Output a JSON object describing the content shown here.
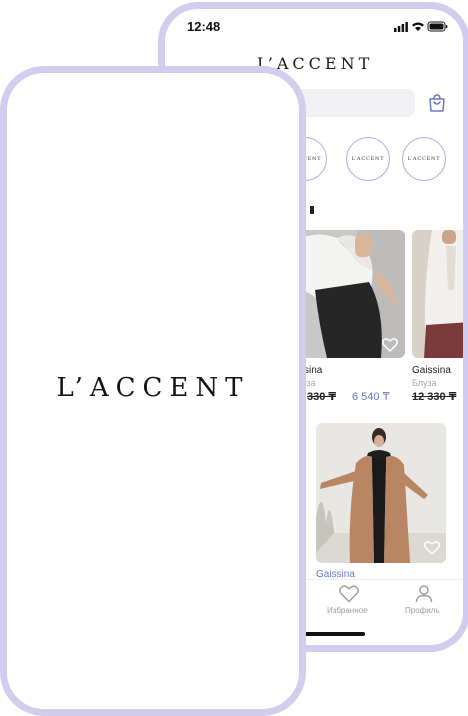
{
  "status": {
    "time": "12:48"
  },
  "brand": {
    "logo": "L’ACCENT"
  },
  "stories": [
    {
      "label": "L’ACCENT"
    },
    {
      "label": "L’ACCENT"
    },
    {
      "label": "L’ACCENT"
    }
  ],
  "products": [
    {
      "brand": "ssina",
      "category": "уза",
      "old_price": "330 ₸",
      "new_price": "6 540 ₸"
    },
    {
      "brand": "Gaissina",
      "category": "Блуза",
      "old_price": "12 330 ₸"
    },
    {
      "brand": "Gaissina"
    }
  ],
  "tabs": [
    {
      "label": "Избранное",
      "icon": "heart-icon"
    },
    {
      "label": "Профиль",
      "icon": "profile-icon"
    }
  ],
  "splash": {
    "logo": "L’ACCENT"
  },
  "colors": {
    "frame": "#d2cdee",
    "accent": "#6b76c7",
    "story_ring": "#b9a6e8"
  }
}
